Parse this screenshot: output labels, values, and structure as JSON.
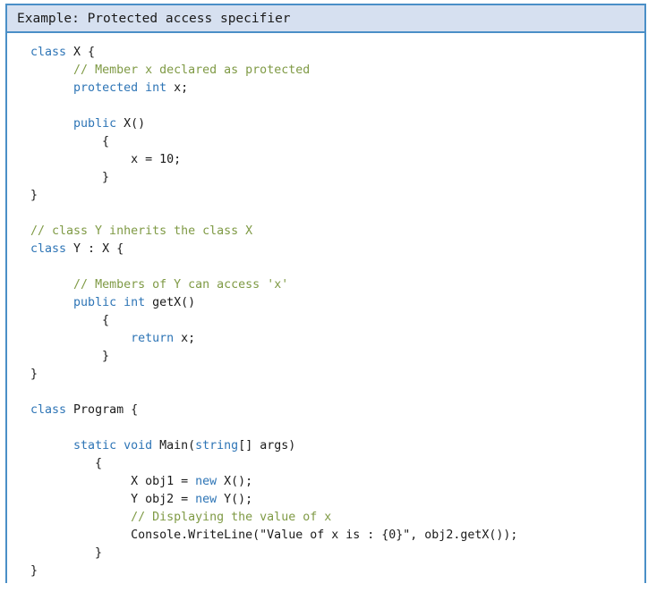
{
  "header": {
    "title": "Example: Protected access specifier"
  },
  "colors": {
    "border": "#4a8fc7",
    "header_bg": "#d6e0f0",
    "code_bg": "#ffffff",
    "keyword": "#2e75b6",
    "comment": "#7f9a45",
    "plain": "#1a1a1a"
  },
  "code": {
    "language": "csharp",
    "lines": [
      {
        "tokens": [
          {
            "t": "class ",
            "c": "kw"
          },
          {
            "t": "X {",
            "c": "pln"
          }
        ]
      },
      {
        "tokens": [
          {
            "t": "      ",
            "c": "pln"
          },
          {
            "t": "// Member x declared as protected",
            "c": "cmt"
          }
        ]
      },
      {
        "tokens": [
          {
            "t": "      ",
            "c": "pln"
          },
          {
            "t": "protected int ",
            "c": "kw"
          },
          {
            "t": "x;",
            "c": "pln"
          }
        ]
      },
      {
        "tokens": []
      },
      {
        "tokens": [
          {
            "t": "      ",
            "c": "pln"
          },
          {
            "t": "public ",
            "c": "kw"
          },
          {
            "t": "X()",
            "c": "pln"
          }
        ]
      },
      {
        "tokens": [
          {
            "t": "          {",
            "c": "pln"
          }
        ]
      },
      {
        "tokens": [
          {
            "t": "              x = 10;",
            "c": "pln"
          }
        ]
      },
      {
        "tokens": [
          {
            "t": "          }",
            "c": "pln"
          }
        ]
      },
      {
        "tokens": [
          {
            "t": "}",
            "c": "pln"
          }
        ]
      },
      {
        "tokens": []
      },
      {
        "tokens": [
          {
            "t": "// class Y inherits the class X",
            "c": "cmt"
          }
        ]
      },
      {
        "tokens": [
          {
            "t": "class ",
            "c": "kw"
          },
          {
            "t": "Y : X {",
            "c": "pln"
          }
        ]
      },
      {
        "tokens": []
      },
      {
        "tokens": [
          {
            "t": "      ",
            "c": "pln"
          },
          {
            "t": "// Members of Y can access 'x'",
            "c": "cmt"
          }
        ]
      },
      {
        "tokens": [
          {
            "t": "      ",
            "c": "pln"
          },
          {
            "t": "public int ",
            "c": "kw"
          },
          {
            "t": "getX()",
            "c": "pln"
          }
        ]
      },
      {
        "tokens": [
          {
            "t": "          {",
            "c": "pln"
          }
        ]
      },
      {
        "tokens": [
          {
            "t": "              ",
            "c": "pln"
          },
          {
            "t": "return ",
            "c": "kw"
          },
          {
            "t": "x;",
            "c": "pln"
          }
        ]
      },
      {
        "tokens": [
          {
            "t": "          }",
            "c": "pln"
          }
        ]
      },
      {
        "tokens": [
          {
            "t": "}",
            "c": "pln"
          }
        ]
      },
      {
        "tokens": []
      },
      {
        "tokens": [
          {
            "t": "class ",
            "c": "kw"
          },
          {
            "t": "Program {",
            "c": "pln"
          }
        ]
      },
      {
        "tokens": []
      },
      {
        "tokens": [
          {
            "t": "      ",
            "c": "pln"
          },
          {
            "t": "static void ",
            "c": "kw"
          },
          {
            "t": "Main(",
            "c": "pln"
          },
          {
            "t": "string",
            "c": "kw"
          },
          {
            "t": "[] args)",
            "c": "pln"
          }
        ]
      },
      {
        "tokens": [
          {
            "t": "         {",
            "c": "pln"
          }
        ]
      },
      {
        "tokens": [
          {
            "t": "              X obj1 = ",
            "c": "pln"
          },
          {
            "t": "new ",
            "c": "kw"
          },
          {
            "t": "X();",
            "c": "pln"
          }
        ]
      },
      {
        "tokens": [
          {
            "t": "              Y obj2 = ",
            "c": "pln"
          },
          {
            "t": "new ",
            "c": "kw"
          },
          {
            "t": "Y();",
            "c": "pln"
          }
        ]
      },
      {
        "tokens": [
          {
            "t": "              ",
            "c": "pln"
          },
          {
            "t": "// Displaying the value of x",
            "c": "cmt"
          }
        ]
      },
      {
        "tokens": [
          {
            "t": "              Console.WriteLine(\"Value of x is : {0}\", obj2.getX());",
            "c": "pln"
          }
        ]
      },
      {
        "tokens": [
          {
            "t": "         }",
            "c": "pln"
          }
        ]
      },
      {
        "tokens": [
          {
            "t": "}",
            "c": "pln"
          }
        ]
      }
    ]
  }
}
